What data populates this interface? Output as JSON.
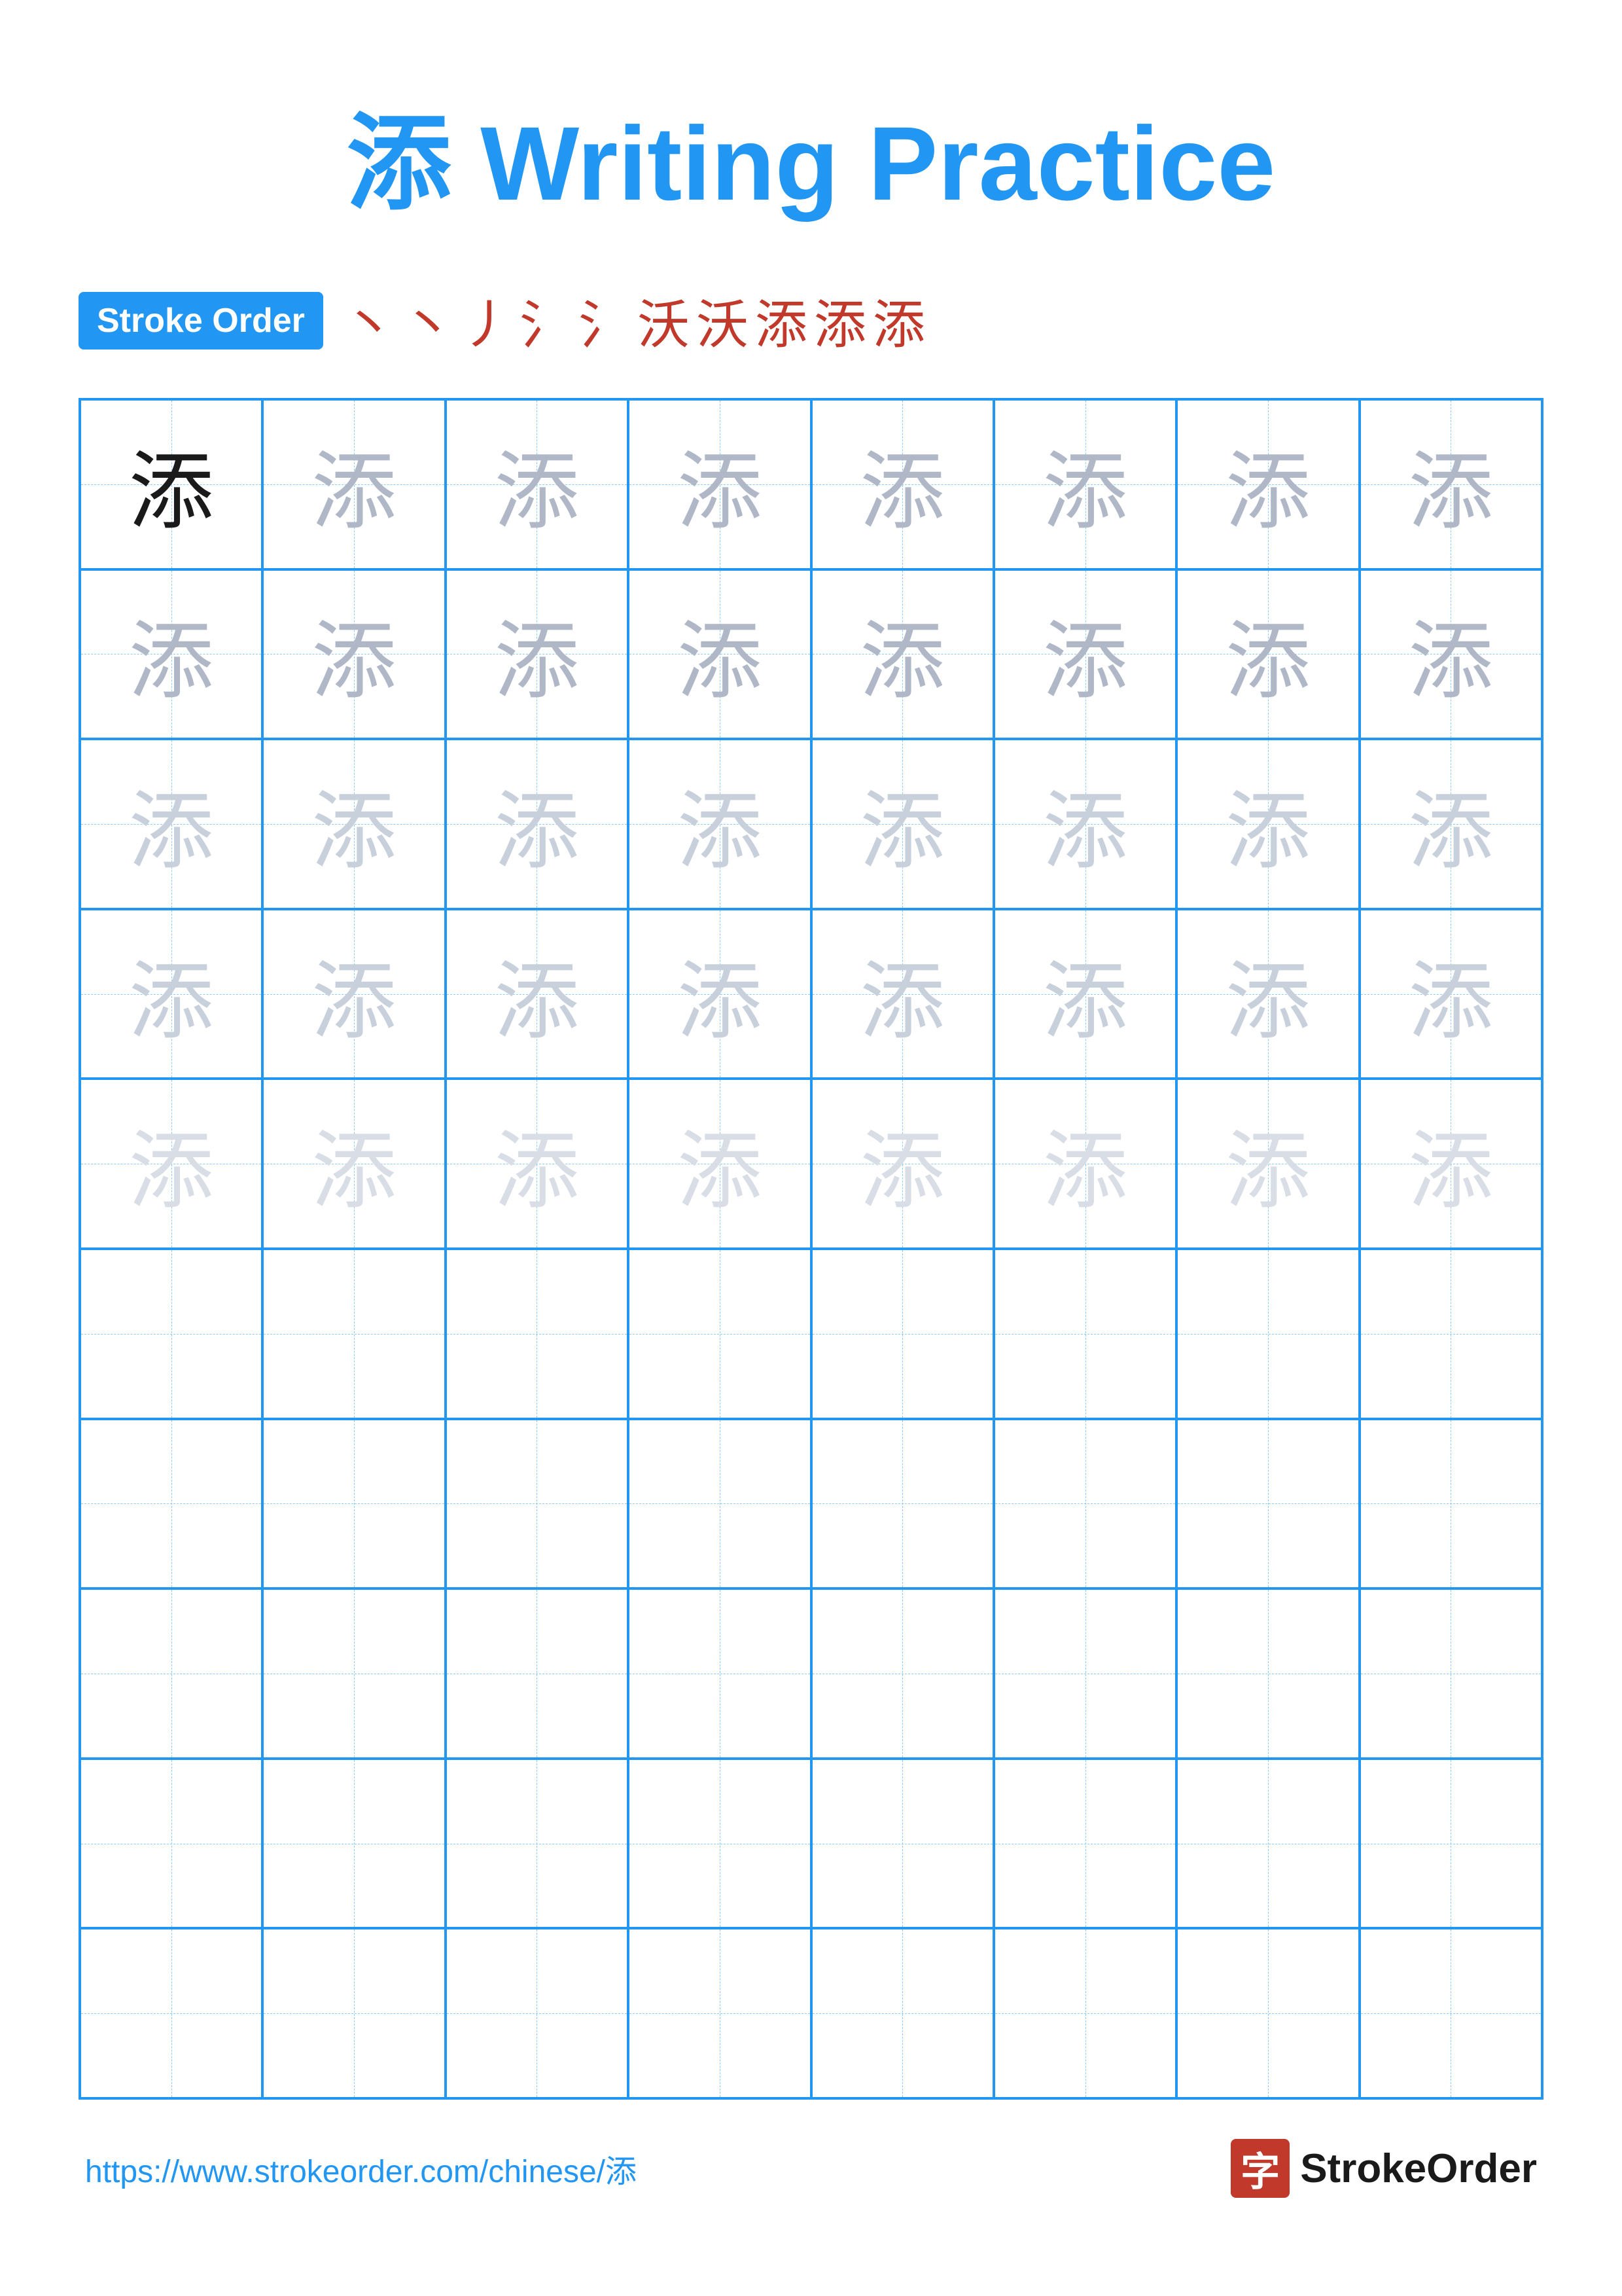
{
  "title": {
    "char": "添",
    "label": "Writing Practice",
    "full": "添 Writing Practice"
  },
  "stroke_order": {
    "badge_label": "Stroke Order",
    "chars": [
      "丶",
      "丶",
      "丿",
      "氵",
      "氵",
      "沃",
      "沃",
      "添",
      "添",
      "添"
    ]
  },
  "grid": {
    "cols": 8,
    "rows": 10,
    "practice_char": "添",
    "row_styles": [
      "dark",
      "light1",
      "light1",
      "light2",
      "light2",
      "light3",
      "light3",
      "light4",
      "light4",
      "empty",
      "empty",
      "empty",
      "empty",
      "empty"
    ]
  },
  "footer": {
    "url": "https://www.strokeorder.com/chinese/添",
    "logo_char": "字",
    "logo_name": "StrokeOrder"
  }
}
